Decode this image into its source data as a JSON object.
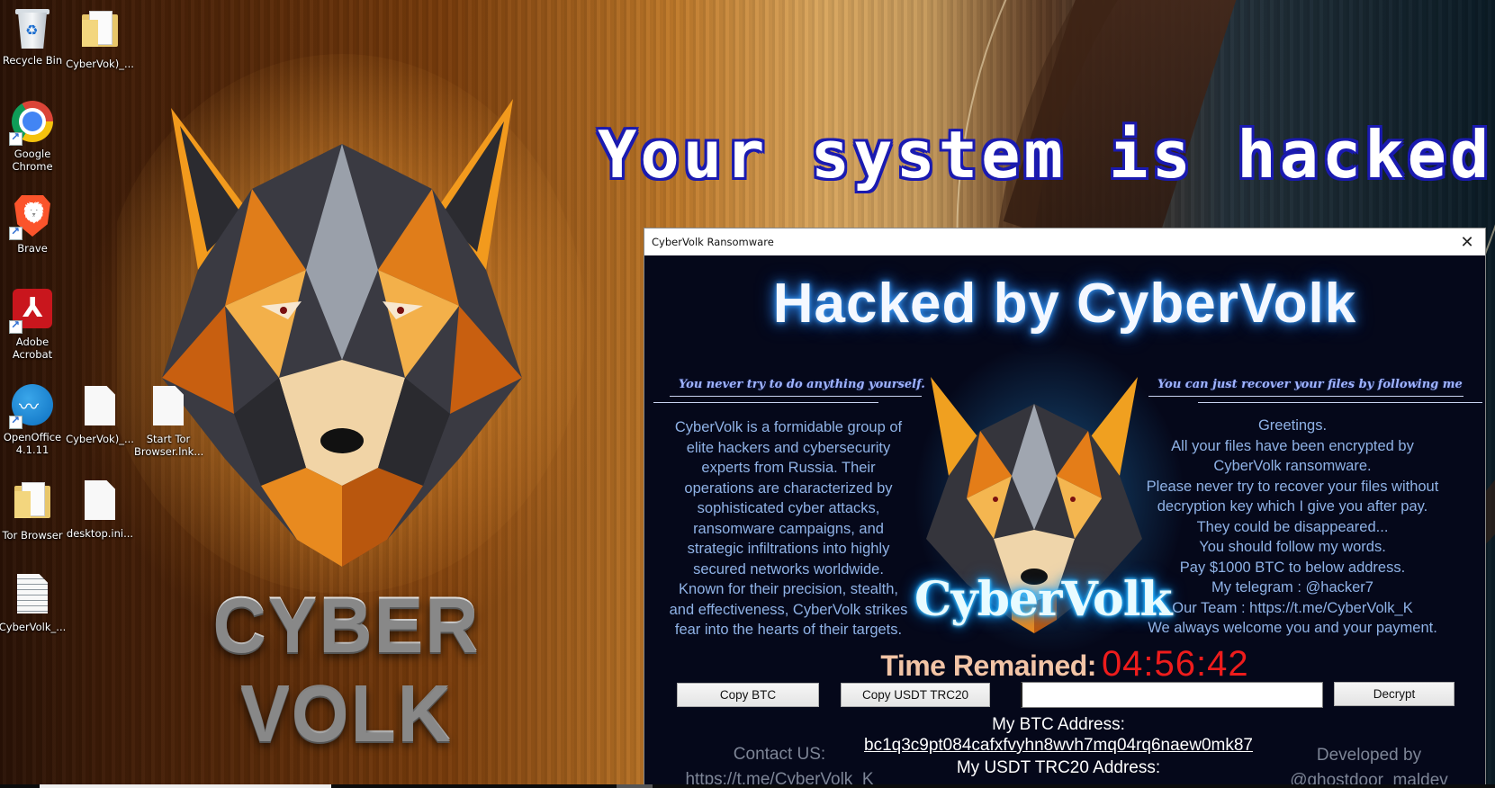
{
  "desktop": {
    "banner": "Your system is hacked",
    "wallpaper_logo": "CYBER VOLK",
    "icons": [
      {
        "label": "Recycle Bin",
        "icon": "recycle-bin-icon"
      },
      {
        "label": "CyberVok)_...",
        "icon": "folder-icon"
      },
      {
        "label": "Google Chrome",
        "icon": "chrome-icon"
      },
      {
        "label": "Brave",
        "icon": "brave-icon"
      },
      {
        "label": "Adobe Acrobat",
        "icon": "acrobat-icon"
      },
      {
        "label": "OpenOffice 4.1.11",
        "icon": "openoffice-icon"
      },
      {
        "label": "CyberVok)_...",
        "icon": "file-icon"
      },
      {
        "label": "Start Tor Browser.lnk...",
        "icon": "file-icon"
      },
      {
        "label": "Tor Browser",
        "icon": "folder-icon"
      },
      {
        "label": "desktop.ini...",
        "icon": "file-icon"
      },
      {
        "label": "CyberVolk_...",
        "icon": "text-file-icon"
      }
    ]
  },
  "window": {
    "title": "CyberVolk Ransomware",
    "close_icon": "close-icon",
    "headline": "Hacked by CyberVolk",
    "slogan_left": "You never try to do anything yourself.",
    "slogan_right": "You can just recover your files by following me",
    "left_text": [
      "CyberVolk is a formidable group of",
      "elite hackers and cybersecurity",
      "experts from Russia. Their",
      "operations are characterized by",
      "sophisticated cyber attacks,",
      "ransomware campaigns, and",
      "strategic infiltrations into highly",
      "secured networks worldwide.",
      "Known for their precision, stealth,",
      "and effectiveness, CyberVolk strikes",
      "fear into the hearts of their targets."
    ],
    "right_text": [
      "Greetings.",
      "All your files have been encrypted by",
      "CyberVolk ransomware.",
      "Please never try to recover your files without",
      "decryption key which I give you after pay.",
      "They could be disappeared...",
      "You should follow my words.",
      "Pay $1000 BTC to below address.",
      "My telegram : @hacker7",
      "Our Team : https://t.me/CyberVolk_K",
      "We always welcome you and your payment."
    ],
    "logo_text": "CyberVolk",
    "timer_label": "Time Remained:",
    "timer_value": "04:56:42",
    "buttons": {
      "copy_btc": "Copy BTC",
      "copy_usdt": "Copy USDT TRC20",
      "decrypt": "Decrypt"
    },
    "key_input": {
      "value": "",
      "placeholder": ""
    },
    "btc_label": "My BTC Address:",
    "btc_address": "bc1q3c9pt084cafxfvyhn8wvh7mq04rq6naew0mk87",
    "usdt_label": "My USDT TRC20 Address:",
    "contact_label": "Contact US:",
    "contact_link": "https://t.me/CyberVolk_K",
    "developed_by_label": "Developed by",
    "developer": "@ghostdoor_maldev"
  },
  "colors": {
    "timer": "#ee1c1c",
    "timer_label": "#f2c4a6",
    "panel_text": "#8fb2e6",
    "window_bg": "#05081a",
    "glow": "#2a7fe0"
  }
}
